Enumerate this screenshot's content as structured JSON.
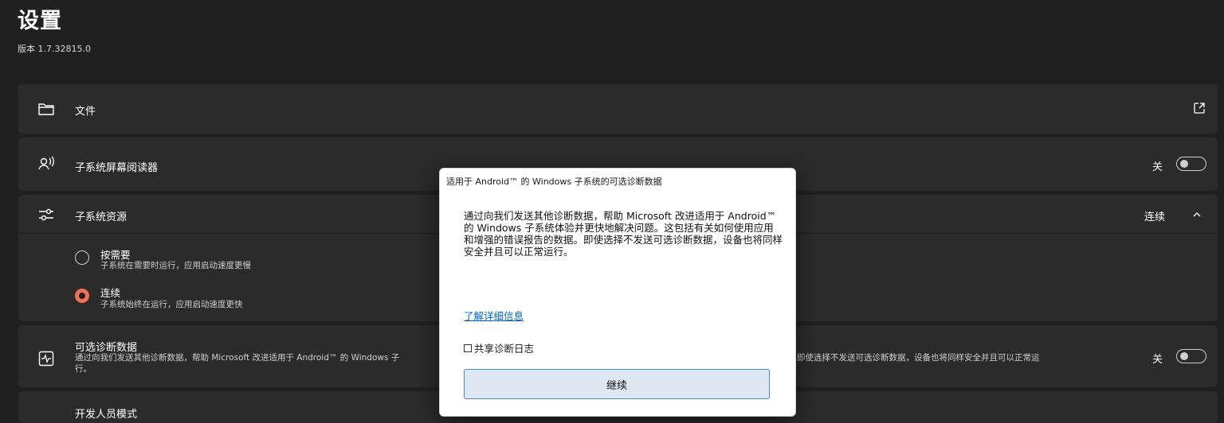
{
  "header": {
    "title": "设置",
    "version": "版本 1.7.32815.0"
  },
  "cards": {
    "files": {
      "label": "文件",
      "icon": "folder-icon",
      "action_icon": "external-link-icon"
    },
    "screen_reader": {
      "label": "子系统屏幕阅读器",
      "icon": "screen-reader-icon",
      "state": "关"
    },
    "resources": {
      "label": "子系统资源",
      "icon": "sliders-icon",
      "state": "连续",
      "options": [
        {
          "title": "按需要",
          "desc": "子系统在需要时运行，应用启动速度更慢",
          "selected": false
        },
        {
          "title": "连续",
          "desc": "子系统始终在运行，应用启动速度更快",
          "selected": true
        }
      ]
    },
    "diagnostics": {
      "label": "可选诊断数据",
      "icon": "activity-monitor-icon",
      "desc_left": "通过向我们发送其他诊断数据，帮助 Microsoft 改进适用于 Android™ 的 Windows 子",
      "desc_right": "即使选择不发送可选诊断数据，设备也将同样安全并且可以正常运",
      "desc_wrap": "行。",
      "state": "关"
    },
    "developer": {
      "label": "开发人员模式"
    }
  },
  "dialog": {
    "title": "适用于 Android™ 的 Windows 子系统的可选诊断数据",
    "body": "通过向我们发送其他诊断数据，帮助 Microsoft 改进适用于 Android™ 的 Windows 子系统体验并更快地解决问题。这包括有关如何使用应用和增强的错误报告的数据。即使选择不发送可选诊断数据，设备也将同样安全并且可以正常运行。",
    "link": "了解详细信息",
    "checkbox_label": "共享诊断日志",
    "checkbox_checked": false,
    "button": "继续"
  },
  "colors": {
    "background": "#202020",
    "card": "#2b2b2b",
    "accent": "#f27052",
    "link": "#0062c7",
    "button_bg": "#dde8f3"
  }
}
